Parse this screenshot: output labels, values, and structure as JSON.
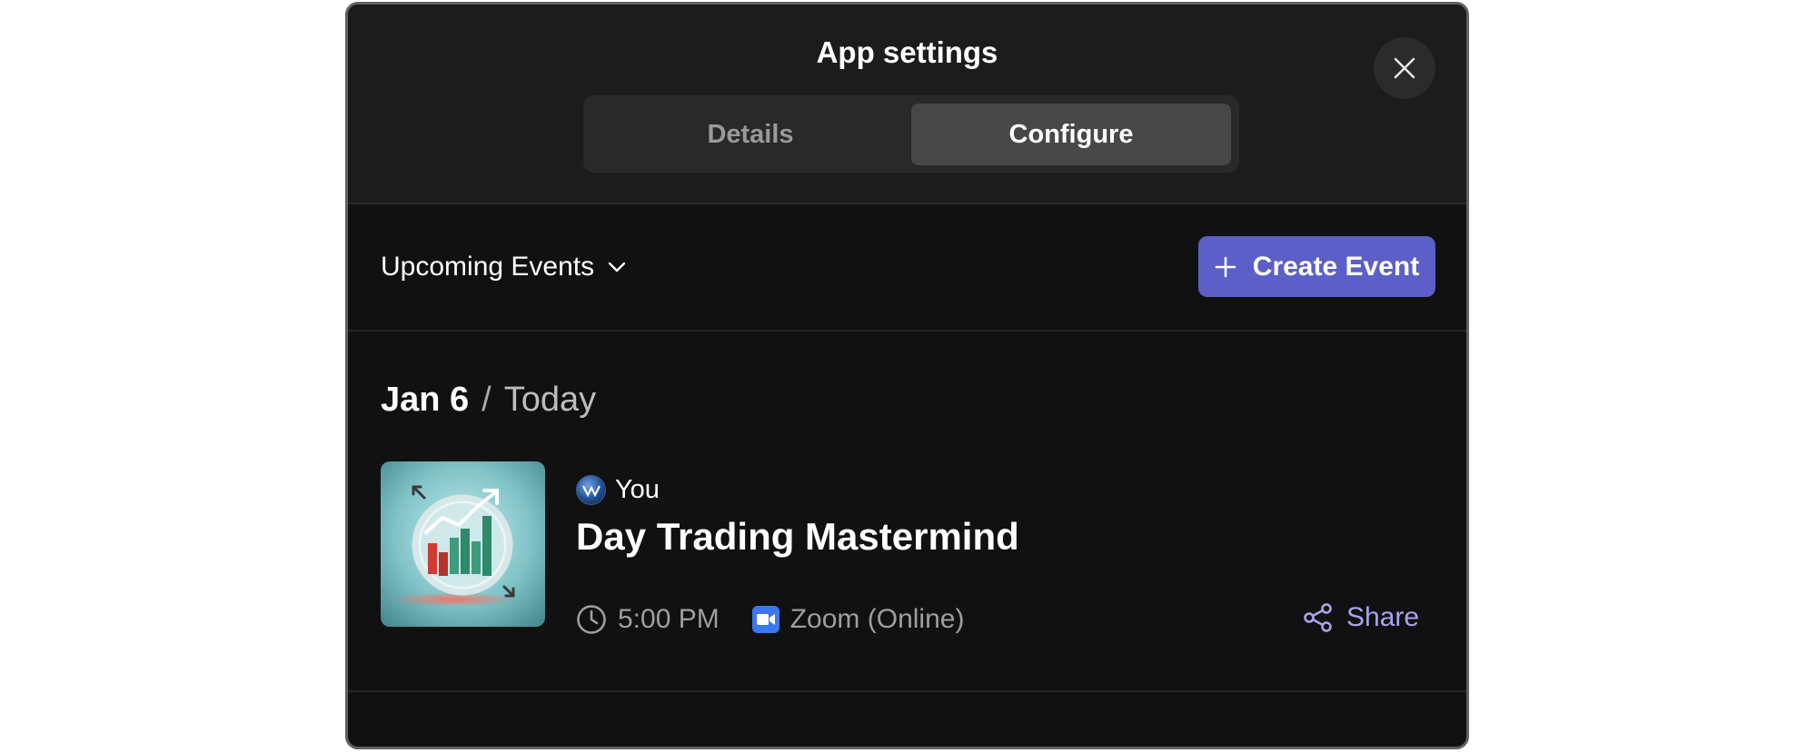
{
  "dialog": {
    "title": "App settings",
    "close_icon": "close-icon",
    "tabs": [
      {
        "label": "Details",
        "selected": false
      },
      {
        "label": "Configure",
        "selected": true
      }
    ]
  },
  "toolbar": {
    "filter_label": "Upcoming Events",
    "filter_icon": "chevron-down-icon",
    "create_label": "Create Event",
    "create_icon": "plus-icon",
    "accent_color": "#5b5fc7"
  },
  "events": {
    "date": "Jan 6",
    "separator": "/",
    "relative_day": "Today",
    "items": [
      {
        "organizer": "You",
        "title": "Day Trading Mastermind",
        "time": "5:00 PM",
        "location": "Zoom (Online)",
        "share_label": "Share",
        "thumbnail": "trading-chart-image",
        "time_icon": "clock-icon",
        "location_icon": "zoom-camera-icon",
        "share_icon": "share-icon"
      }
    ]
  }
}
